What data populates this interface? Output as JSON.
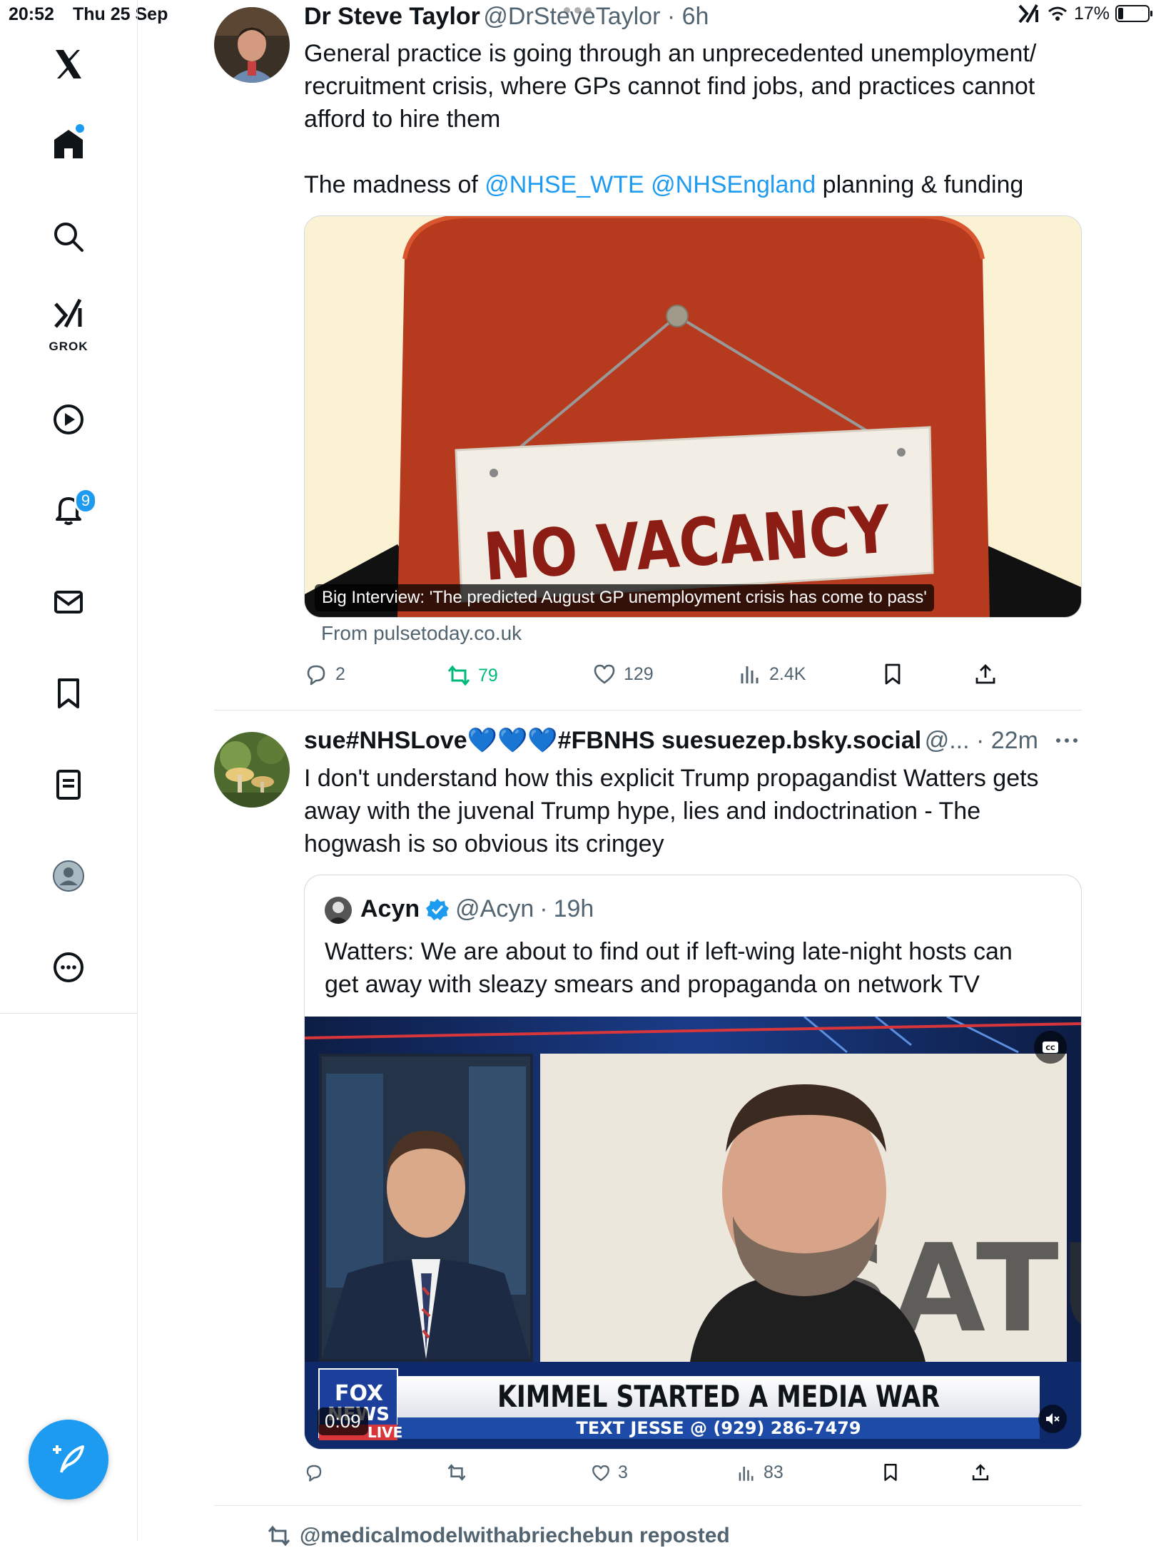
{
  "status_bar": {
    "time": "20:52",
    "date": "Thu 25 Sep",
    "battery": "17%",
    "battery_level": 0.17
  },
  "sidebar": {
    "items": [
      {
        "name": "home",
        "icon": "home-icon"
      },
      {
        "name": "explore",
        "icon": "search-icon"
      },
      {
        "name": "grok",
        "icon": "grok-icon",
        "label": "GROK"
      },
      {
        "name": "video",
        "icon": "play-icon"
      },
      {
        "name": "notifications",
        "icon": "bell-icon",
        "badge": "9"
      },
      {
        "name": "messages",
        "icon": "envelope-icon"
      },
      {
        "name": "bookmarks",
        "icon": "bookmark-icon"
      },
      {
        "name": "lists",
        "icon": "list-icon"
      },
      {
        "name": "profile",
        "icon": "avatar-icon"
      },
      {
        "name": "more",
        "icon": "more-circle-icon"
      }
    ],
    "compose_icon": "compose-icon",
    "accent": "#1d9bf0"
  },
  "tweet1": {
    "name": "Dr Steve Taylor",
    "handle": "@DrSteveTaylor",
    "time": "6h",
    "text_line1": "General practice is going through an unprecedented unemployment/",
    "text_line2": "recruitment crisis, where GPs cannot find jobs, and practices cannot",
    "text_line3": "afford to hire them",
    "text2_prefix": "The madness of ",
    "mention1": "@NHSE_WTE",
    "mention2": "@NHSEngland",
    "text2_suffix": " planning & funding",
    "card_sign_text": "NO VACANCY",
    "card_caption": "Big Interview: 'The predicted August GP unemployment crisis has come to pass'",
    "card_source": "From pulsetoday.co.uk",
    "replies": "2",
    "reposts": "79",
    "likes": "129",
    "views": "2.4K"
  },
  "tweet2": {
    "name_prefix": "sue#NHSLove",
    "hearts": "💙💙💙",
    "name_suffix": "#FBNHS suesuezep.bsky.social",
    "handle": "@...",
    "time": "22m",
    "text_line1": "I don't understand how this explicit Trump propagandist Watters gets",
    "text_line2": "away with the juvenal Trump hype, lies and indoctrination - The",
    "text_line3": "hogwash is so obvious its cringey",
    "quote": {
      "name": "Acyn",
      "handle": "@Acyn",
      "time": "19h",
      "text_line1": "Watters: We are about to find out if left-wing late-night hosts can",
      "text_line2": "get away with sleazy smears and propaganda on network TV",
      "video_time": "0:09",
      "chyron_headline": "KIMMEL STARTED A MEDIA WAR",
      "chyron_sub": "TEXT JESSE @ (929) 286-7479",
      "network": "FOX NEWS",
      "live": "LIVE",
      "backdrop_text": "SATURDAY"
    },
    "replies": "",
    "reposts": "",
    "likes": "3",
    "views": "83"
  },
  "next_item": {
    "text": "@medicalmodelwithabriechebun reposted"
  }
}
